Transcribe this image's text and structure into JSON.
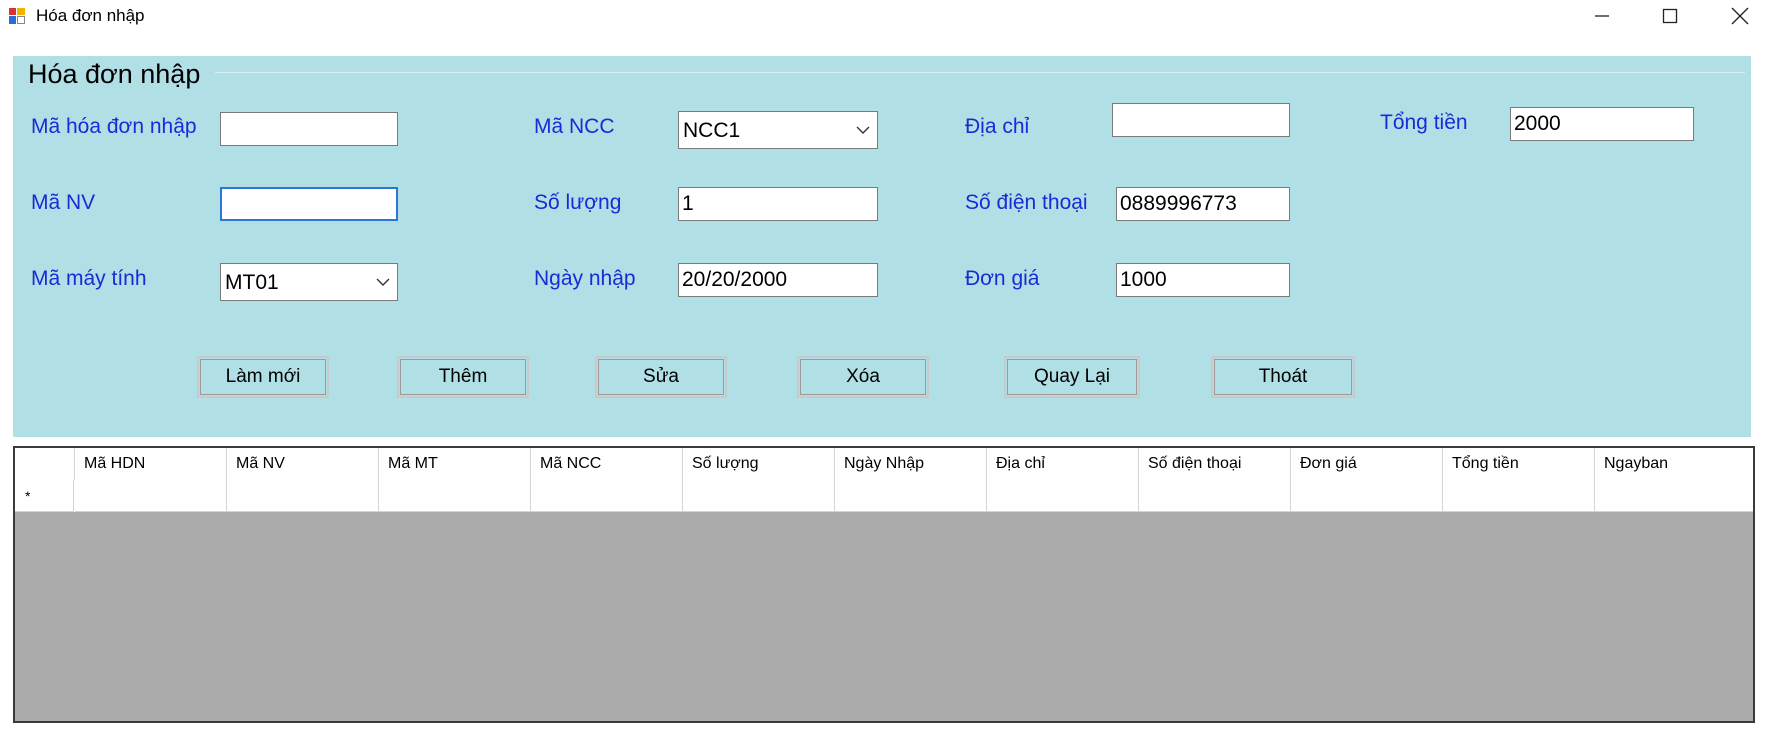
{
  "window": {
    "title": "Hóa đơn nhập",
    "controls": [
      "minimize-icon",
      "maximize-icon",
      "close-icon"
    ]
  },
  "group": {
    "title": "Hóa đơn nhập"
  },
  "form": {
    "ma_hdn": {
      "label": "Mã hóa đơn nhập",
      "value": ""
    },
    "ma_ncc": {
      "label": "Mã NCC",
      "value": "NCC1"
    },
    "dia_chi": {
      "label": "Địa chỉ",
      "value": ""
    },
    "tong_tien": {
      "label": "Tổng tiền",
      "value": "2000"
    },
    "ma_nv": {
      "label": "Mã NV",
      "value": ""
    },
    "so_luong": {
      "label": "Số lượng",
      "value": "1"
    },
    "so_dien_thoai": {
      "label": "Số điện thoại",
      "value": "0889996773"
    },
    "ma_may_tinh": {
      "label": "Mã máy tính",
      "value": "MT01"
    },
    "ngay_nhap": {
      "label": "Ngày nhập",
      "value": "20/20/2000"
    },
    "don_gia": {
      "label": "Đơn giá",
      "value": "1000"
    }
  },
  "buttons": {
    "lam_moi": "Làm mới",
    "them": "Thêm",
    "sua": "Sửa",
    "xoa": "Xóa",
    "quay_lai": "Quay Lại",
    "thoat": "Thoát"
  },
  "grid": {
    "columns": [
      "Mã HDN",
      "Mã NV",
      "Mã MT",
      "Mã NCC",
      "Số lượng",
      "Ngày Nhập",
      "Địa chỉ",
      "Số điện thoại",
      "Đơn giá",
      "Tổng tiền",
      "Ngayban"
    ],
    "new_row_marker": "*",
    "colors": {
      "empty_area": "#ababab"
    }
  },
  "colors": {
    "panel": "#b0dfe5",
    "label": "#1a2ad6",
    "focus": "#2a78d6"
  }
}
